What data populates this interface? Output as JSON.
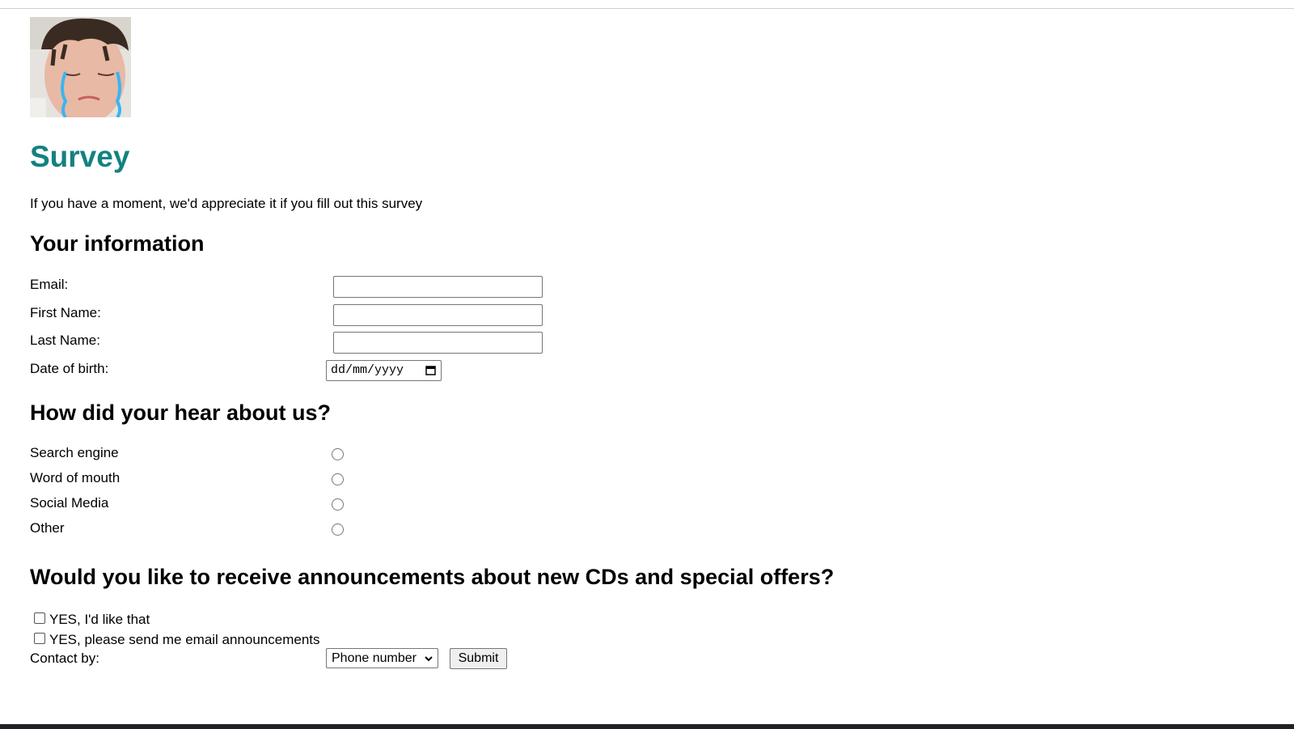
{
  "logo": {
    "alt": "crying child photo"
  },
  "title": "Survey",
  "intro": "If you have a moment, we'd appreciate it if you fill out this survey",
  "info_section": {
    "heading": "Your information",
    "email_label": "Email:",
    "email_value": "",
    "first_name_label": "First Name:",
    "first_name_value": "",
    "last_name_label": "Last Name:",
    "last_name_value": "",
    "dob_label": "Date of birth:",
    "dob_placeholder": "dd/mm/yyyy"
  },
  "hear_section": {
    "heading": "How did your hear about us?",
    "options": [
      "Search engine",
      "Word of mouth",
      "Social Media",
      "Other"
    ]
  },
  "announce_section": {
    "heading": "Would you like to receive announcements about new CDs and special offers?",
    "checkboxes": [
      "YES, I'd like that",
      "YES, please send me email announcements"
    ],
    "contact_label": "Contact by:",
    "contact_selected": "Phone number",
    "submit_label": "Submit"
  },
  "icons": {
    "calendar": "calendar-icon",
    "dropdown": "chevron-down-icon"
  },
  "colors": {
    "title": "#128280",
    "tear": "#3ab4f2"
  }
}
